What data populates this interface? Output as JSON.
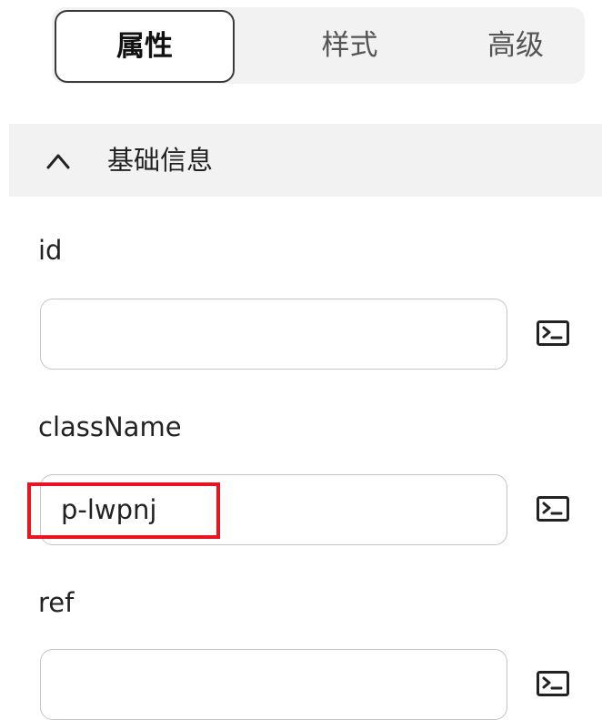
{
  "tabs": [
    {
      "label": "属性",
      "active": true
    },
    {
      "label": "样式",
      "active": false
    },
    {
      "label": "高级",
      "active": false
    }
  ],
  "section": {
    "title": "基础信息",
    "expanded": true,
    "chevron_icon": "chevron-up-icon"
  },
  "fields": [
    {
      "label": "id",
      "value": "",
      "action_icon": "terminal-icon"
    },
    {
      "label": "className",
      "value": "p-lwpnj",
      "action_icon": "terminal-icon"
    },
    {
      "label": "ref",
      "value": "",
      "action_icon": "terminal-icon"
    }
  ],
  "annotation": {
    "highlight_color": "#e8141f"
  }
}
